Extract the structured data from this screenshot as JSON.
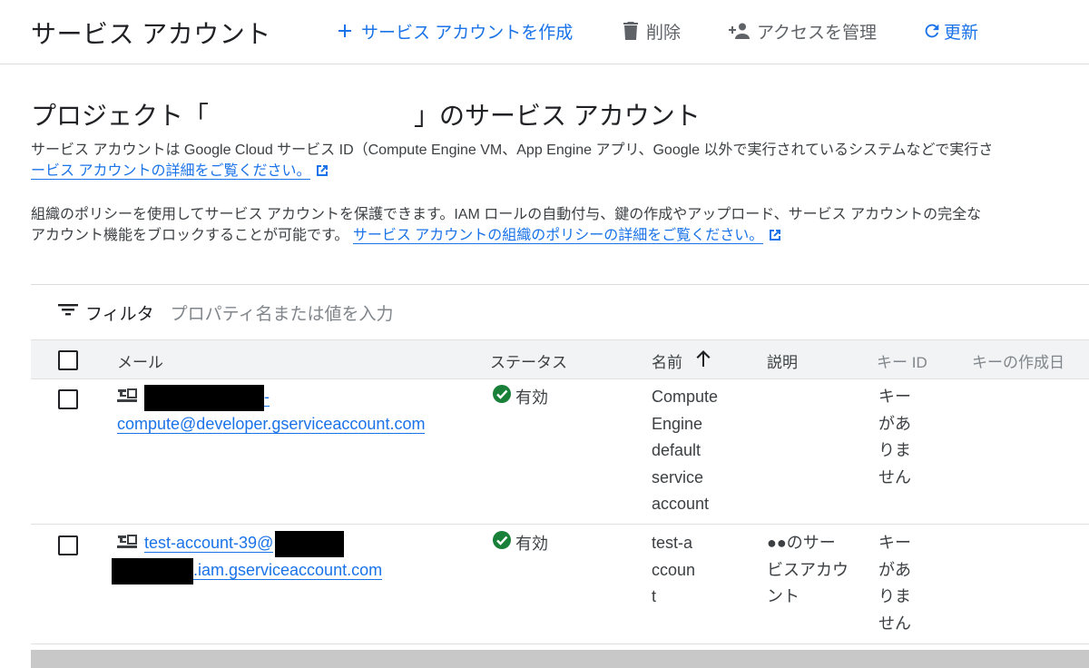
{
  "toolbar": {
    "title": "サービス アカウント",
    "create_label": "サービス アカウントを作成",
    "delete_label": "削除",
    "access_label": "アクセスを管理",
    "refresh_label": "更新"
  },
  "heading": {
    "prefix": "プロジェクト「",
    "suffix": "」のサービス アカウント"
  },
  "description1": {
    "text": "サービス アカウントは Google Cloud サービス ID（Compute Engine VM、App Engine アプリ、Google 以外で実行されているシステムなどで実行さ",
    "link": "ービス アカウントの詳細をご覧ください。"
  },
  "description2": {
    "text1": "組織のポリシーを使用してサービス アカウントを保護できます。IAM ロールの自動付与、鍵の作成やアップロード、サービス アカウントの完全な",
    "text2": "アカウント機能をブロックすることが可能です。",
    "link": "サービス アカウントの組織のポリシーの詳細をご覧ください。"
  },
  "filter": {
    "label": "フィルタ",
    "placeholder": "プロパティ名または値を入力"
  },
  "table": {
    "columns": {
      "email": "メール",
      "status": "ステータス",
      "name": "名前",
      "description": "説明",
      "key_id": "キー ID",
      "key_created": "キーの作成日"
    },
    "rows": [
      {
        "email_line1_suffix": "-",
        "email_line2": "compute@developer.gserviceaccount.com",
        "status": "有効",
        "name": "Compute Engine default service account",
        "description": "",
        "key_id": "キーがありません"
      },
      {
        "email_line1": "test-account-39@",
        "email_line2_suffix": ".iam.gserviceaccount.com",
        "status": "有効",
        "name": "test-account",
        "description": "●●のサービスアカウント",
        "key_id": "キーがありません"
      }
    ]
  },
  "colors": {
    "primary": "#1a73e8",
    "success": "#188038",
    "text": "#202124",
    "muted": "#5f6368"
  }
}
